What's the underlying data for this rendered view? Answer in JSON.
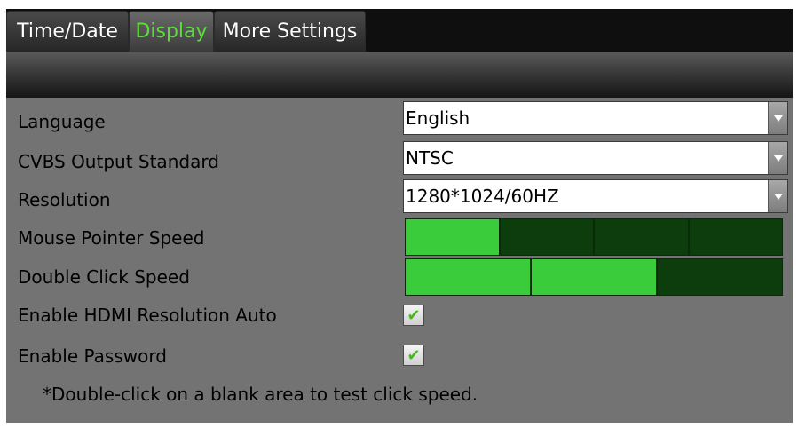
{
  "tabs": [
    {
      "label": "Time/Date",
      "active": false
    },
    {
      "label": "Display",
      "active": true
    },
    {
      "label": "More Settings",
      "active": false
    }
  ],
  "settings": {
    "language": {
      "label": "Language",
      "value": "English"
    },
    "cvbs": {
      "label": "CVBS Output Standard",
      "value": "NTSC"
    },
    "resolution": {
      "label": "Resolution",
      "value": "1280*1024/60HZ"
    },
    "mouse_speed": {
      "label": "Mouse Pointer Speed",
      "level": 1,
      "max": 4
    },
    "double_click_speed": {
      "label": "Double Click Speed",
      "level": 2,
      "max": 3
    },
    "hdmi_auto": {
      "label": "Enable HDMI Resolution Auto",
      "checked": true
    },
    "password": {
      "label": "Enable Password",
      "checked": true
    }
  },
  "note": "*Double-click on a blank area to test click speed.",
  "colors": {
    "active_tab": "#5bdc3a",
    "speed_on": "#3bcc3b",
    "speed_off": "#0d3d0d",
    "check": "#49b71e"
  },
  "icons": {
    "dropdown": "chevron-down-icon",
    "checkmark": "checkmark-icon"
  }
}
